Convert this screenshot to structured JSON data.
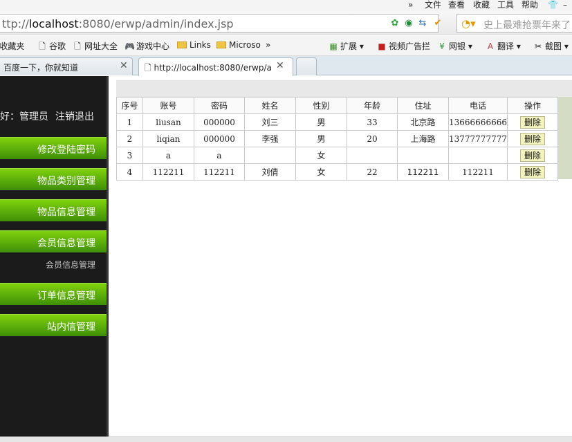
{
  "browser": {
    "menu": [
      "»",
      "文件",
      "查看",
      "收藏",
      "工具",
      "帮助"
    ],
    "address": {
      "prefix": "ttp://",
      "host": "localhost",
      "rest": ":8080/erwp/admin/index.jsp"
    },
    "search_placeholder": "史上最难抢票年来了",
    "bookmarks": [
      {
        "label": "l收藏夹",
        "icon": "star-icon"
      },
      {
        "label": "谷歌",
        "icon": "page-icon"
      },
      {
        "label": "网址大全",
        "icon": "page-icon"
      },
      {
        "label": "游戏中心",
        "icon": "gamepad-icon"
      },
      {
        "label": "Links",
        "icon": "folder-icon"
      },
      {
        "label": "Microso",
        "icon": "folder-icon"
      },
      {
        "label": "»",
        "icon": ""
      },
      {
        "label": "扩展",
        "icon": "extension-icon"
      },
      {
        "label": "视频广告拦",
        "icon": "adblock-icon"
      },
      {
        "label": "网银",
        "icon": "bank-icon"
      },
      {
        "label": "翻译",
        "icon": "translate-icon"
      },
      {
        "label": "截图",
        "icon": "scissors-icon"
      }
    ],
    "tabs": [
      {
        "label": "百度一下，你就知道",
        "active": false
      },
      {
        "label": "http://localhost:8080/erwp/a",
        "active": true
      }
    ]
  },
  "sidebar": {
    "greeting": "好：管理员",
    "logout": "注销退出",
    "menu": [
      {
        "label": "修改登陆密码"
      },
      {
        "label": "物品类别管理"
      },
      {
        "label": "物品信息管理"
      },
      {
        "label": "会员信息管理",
        "sub": "会员信息管理"
      },
      {
        "label": "订单信息管理"
      },
      {
        "label": "站内信管理"
      }
    ]
  },
  "table": {
    "headers": [
      "序号",
      "账号",
      "密码",
      "姓名",
      "性别",
      "年龄",
      "住址",
      "电话",
      "操作"
    ],
    "rows": [
      [
        "1",
        "liusan",
        "000000",
        "刘三",
        "男",
        "33",
        "北京路",
        "13666666666"
      ],
      [
        "2",
        "liqian",
        "000000",
        "李强",
        "男",
        "20",
        "上海路",
        "13777777777"
      ],
      [
        "3",
        "a",
        "a",
        "",
        "女",
        "",
        "",
        ""
      ],
      [
        "4",
        "112211",
        "112211",
        "刘倩",
        "女",
        "22",
        "112211",
        "112211"
      ]
    ],
    "delete_label": "删除"
  }
}
